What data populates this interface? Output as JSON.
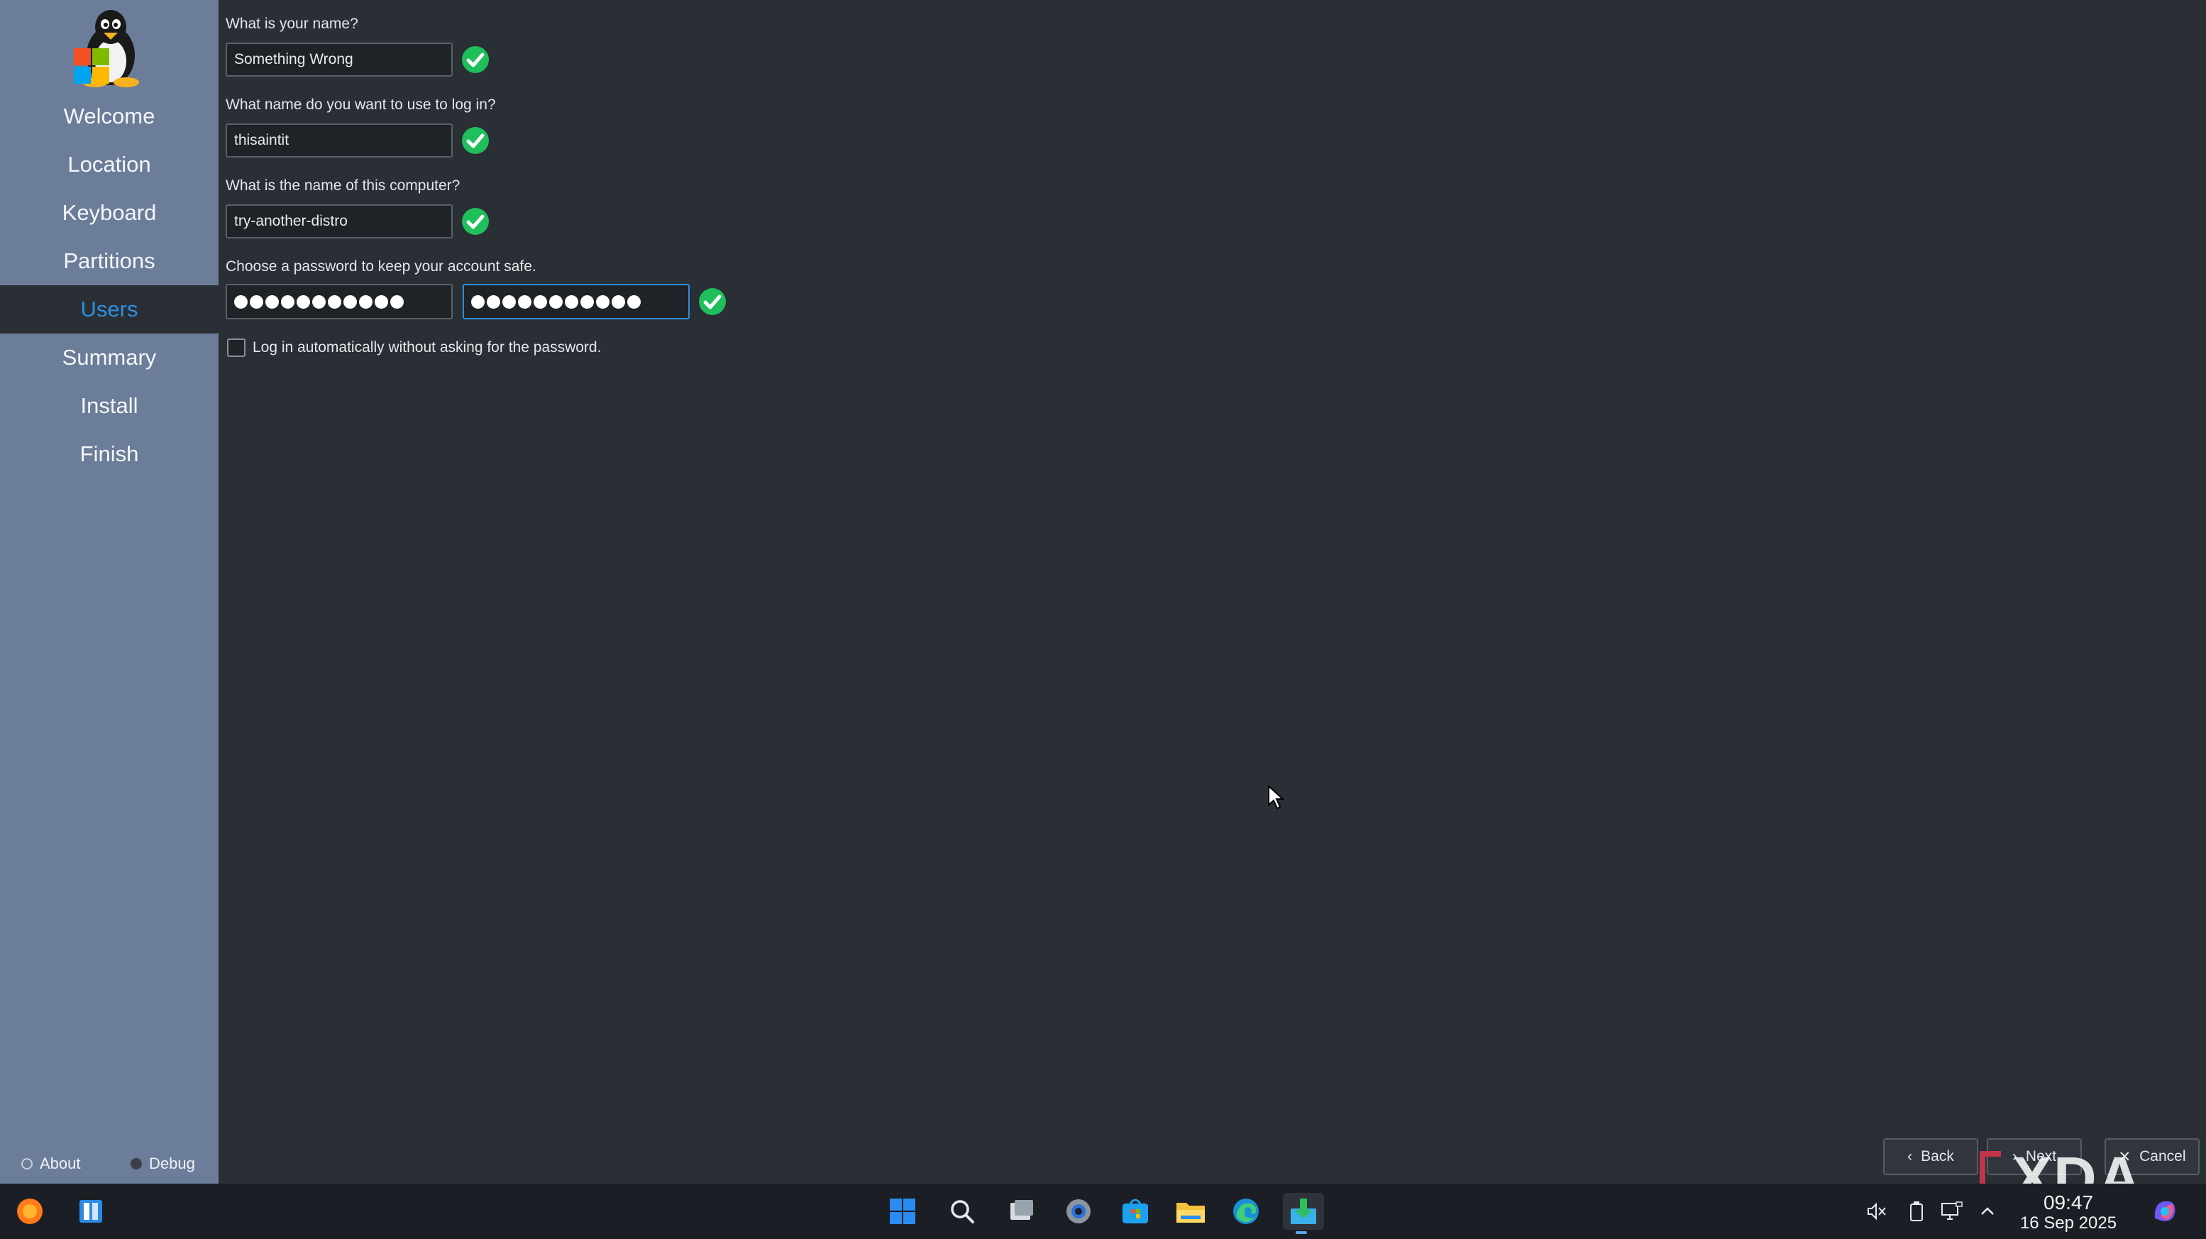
{
  "sidebar": {
    "items": [
      {
        "label": "Welcome"
      },
      {
        "label": "Location"
      },
      {
        "label": "Keyboard"
      },
      {
        "label": "Partitions"
      },
      {
        "label": "Users",
        "active": true
      },
      {
        "label": "Summary"
      },
      {
        "label": "Install"
      },
      {
        "label": "Finish"
      }
    ],
    "footer": {
      "about_label": "About",
      "debug_label": "Debug"
    }
  },
  "form": {
    "name": {
      "label": "What is your name?",
      "value": "Something Wrong"
    },
    "login": {
      "label": "What name do you want to use to log in?",
      "value": "thisaintit"
    },
    "computer": {
      "label": "What is the name of this computer?",
      "value": "try-another-distro"
    },
    "password": {
      "label": "Choose a password to keep your account safe.",
      "dot_count": 11
    },
    "autologin": {
      "label": "Log in automatically without asking for the password.",
      "checked": false
    }
  },
  "buttons": {
    "back_label": "Back",
    "next_label": "Next",
    "cancel_label": "Cancel"
  },
  "watermark": "XDA",
  "taskbar": {
    "apps": [
      "firefox-icon",
      "app-icon",
      "start-icon",
      "search-icon",
      "task-view-icon",
      "settings-icon",
      "store-icon",
      "file-explorer-icon",
      "edge-icon",
      "installer-icon"
    ],
    "tray": [
      "volume-muted-icon",
      "battery-icon",
      "network-icon",
      "chevron-up-icon",
      "copilot-icon"
    ],
    "clock_time": "09:47",
    "clock_date": "16 Sep 2025"
  },
  "colors": {
    "accent": "#2f8fde",
    "sidebar": "#6b7d98",
    "background": "#2a2e35",
    "check": "#1fbf5b"
  }
}
